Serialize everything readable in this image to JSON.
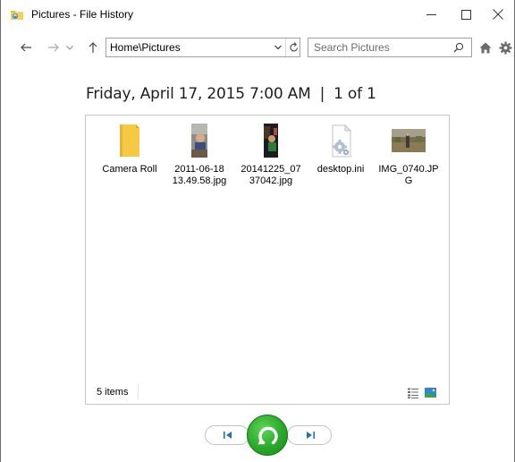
{
  "window": {
    "title": "Pictures - File History"
  },
  "navigation": {
    "address": "Home\\Pictures",
    "search_placeholder": "Search Pictures"
  },
  "header": {
    "date": "Friday, April 17, 2015 7:00 AM",
    "separator": "|",
    "position": "1 of 1"
  },
  "files": [
    {
      "label": "Camera Roll",
      "type": "folder-icon"
    },
    {
      "label": "2011-06-18 13.49.58.jpg",
      "type": "photo-thumbnail"
    },
    {
      "label": "20141225_0737042.jpg",
      "type": "photo-thumbnail"
    },
    {
      "label": "desktop.ini",
      "type": "settings-file-icon"
    },
    {
      "label": "IMG_0740.JPG",
      "type": "photo-thumbnail"
    }
  ],
  "status": {
    "item_count": "5 items"
  },
  "colors": {
    "restore_green": "#2aa72a",
    "folder_yellow": "#f6c945",
    "border_gray": "#c6c6c6"
  }
}
